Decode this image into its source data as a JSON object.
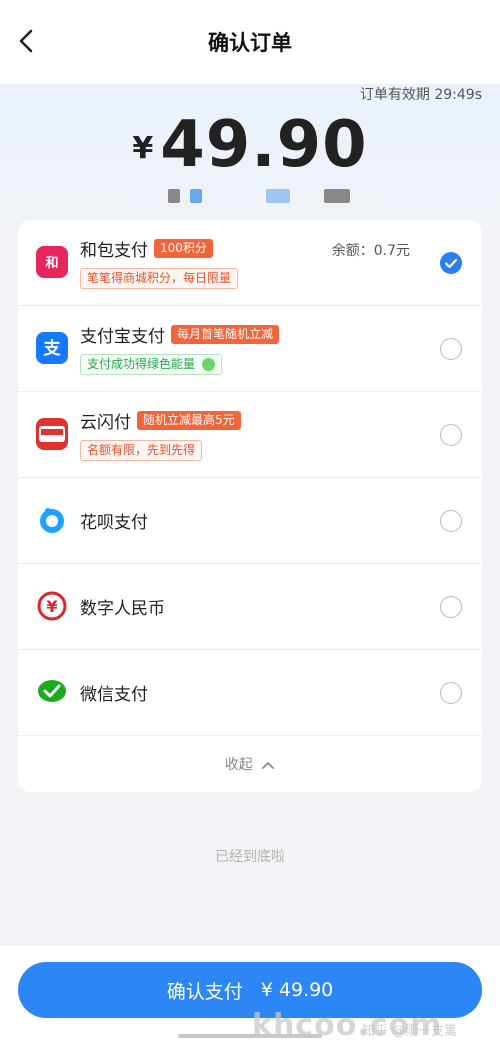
{
  "header": {
    "title": "确认订单"
  },
  "summary": {
    "validity": "订单有效期 29:49s",
    "currency": "¥",
    "amount": "49.90"
  },
  "methods": [
    {
      "name": "和包支付",
      "badge": "100积分",
      "subtitle": "笔笔得商城积分，每日限量",
      "balance": "余额：0.7元",
      "selected": true,
      "icon": "hebao-icon"
    },
    {
      "name": "支付宝支付",
      "badge": "每月首笔随机立减",
      "subtitle": "支付成功得绿色能量",
      "selected": false,
      "icon": "alipay-icon"
    },
    {
      "name": "云闪付",
      "badge": "随机立减最高5元",
      "subtitle": "名额有限，先到先得",
      "selected": false,
      "icon": "unionpay-icon"
    },
    {
      "name": "花呗支付",
      "selected": false,
      "icon": "huabei-icon"
    },
    {
      "name": "数字人民币",
      "selected": false,
      "icon": "ecny-icon"
    },
    {
      "name": "微信支付",
      "selected": false,
      "icon": "wechat-pay-icon"
    }
  ],
  "collapse_label": "收起",
  "end_text": "已经到底啦",
  "confirm": {
    "label": "确认支付",
    "amount": "¥ 49.90"
  },
  "watermark": {
    "main": "khcoo.com",
    "sub": "知乎 @雨一支篱"
  },
  "colors": {
    "accent": "#2d86f5",
    "badge": "#f2643a"
  }
}
